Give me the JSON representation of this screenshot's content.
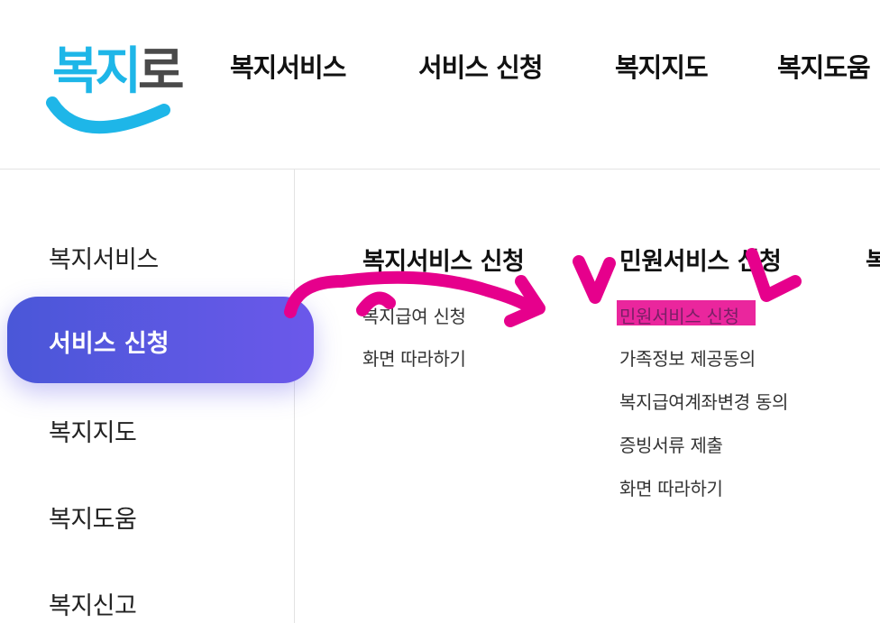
{
  "header": {
    "logo": {
      "text_part1": "복지",
      "text_part2": "로",
      "colors": {
        "primary": "#1eb6e8",
        "secondary": "#4a4a4a"
      }
    },
    "nav": [
      {
        "label": "복지서비스"
      },
      {
        "label": "서비스 신청"
      },
      {
        "label": "복지지도"
      },
      {
        "label": "복지도움"
      }
    ]
  },
  "sidebar": {
    "items": [
      {
        "label": "복지서비스",
        "active": false
      },
      {
        "label": "서비스 신청",
        "active": true
      },
      {
        "label": "복지지도",
        "active": false
      },
      {
        "label": "복지도움",
        "active": false
      },
      {
        "label": "복지신고",
        "active": false
      }
    ],
    "active_gradient": [
      "#4a57d8",
      "#6b58ea"
    ]
  },
  "submenu": {
    "columns": [
      {
        "title": "복지서비스 신청",
        "links": [
          "복지급여 신청",
          "화면 따라하기"
        ]
      },
      {
        "title": "민원서비스 신청",
        "links": [
          "민원서비스 신청",
          "가족정보 제공동의",
          "복지급여계좌변경 동의",
          "증빙서류 제출",
          "화면 따라하기"
        ]
      }
    ],
    "third_column_peek": "복"
  },
  "annotation": {
    "color": "#e6008c"
  }
}
